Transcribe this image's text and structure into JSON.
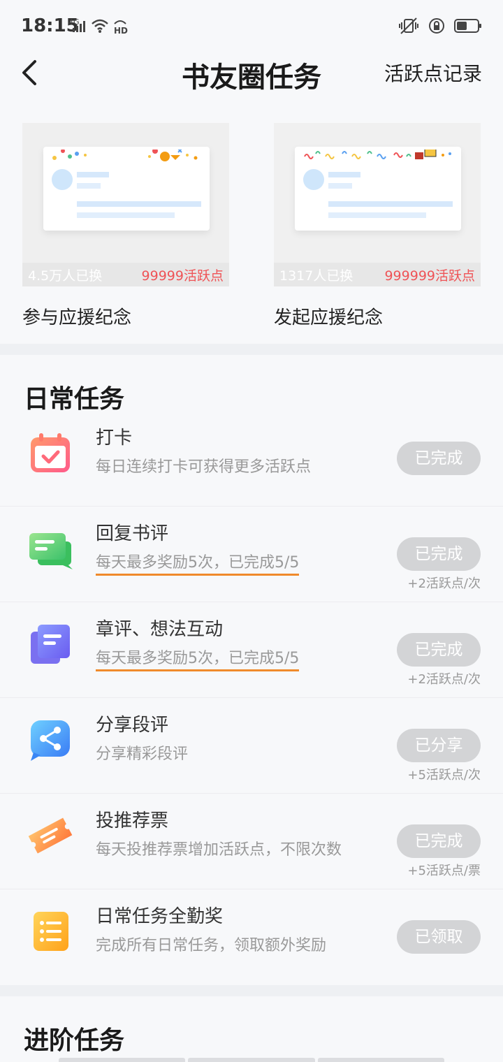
{
  "status_bar": {
    "time": "18:15",
    "network": "4G",
    "hd": "HD"
  },
  "nav": {
    "title": "书友圈任务",
    "right_link": "活跃点记录"
  },
  "cards": [
    {
      "count": "4.5万人已换",
      "price": "99999活跃点",
      "label": "参与应援纪念"
    },
    {
      "count": "1317人已换",
      "price": "999999活跃点",
      "label": "发起应援纪念"
    }
  ],
  "daily": {
    "title": "日常任务",
    "tasks": [
      {
        "name": "打卡",
        "desc": "每日连续打卡可获得更多活跃点",
        "button": "已完成",
        "reward": "",
        "icon": "calendar-check-icon"
      },
      {
        "name": "回复书评",
        "desc": "每天最多奖励5次，已完成5/5",
        "button": "已完成",
        "reward": "+2活跃点/次",
        "icon": "chat-bubble-icon"
      },
      {
        "name": "章评、想法互动",
        "desc": "每天最多奖励5次，已完成5/5",
        "button": "已完成",
        "reward": "+2活跃点/次",
        "icon": "note-stack-icon"
      },
      {
        "name": "分享段评",
        "desc": "分享精彩段评",
        "button": "已分享",
        "reward": "+5活跃点/次",
        "icon": "share-icon"
      },
      {
        "name": "投推荐票",
        "desc": "每天投推荐票增加活跃点，不限次数",
        "button": "已完成",
        "reward": "+5活跃点/票",
        "icon": "ticket-icon"
      },
      {
        "name": "日常任务全勤奖",
        "desc": "完成所有日常任务，领取额外奖励",
        "button": "已领取",
        "reward": "",
        "icon": "list-icon"
      }
    ]
  },
  "advanced": {
    "title": "进阶任务"
  },
  "colors": {
    "accent_red": "#ef5356",
    "underline_orange": "#f08a2b",
    "button_gray": "#d3d4d6"
  }
}
